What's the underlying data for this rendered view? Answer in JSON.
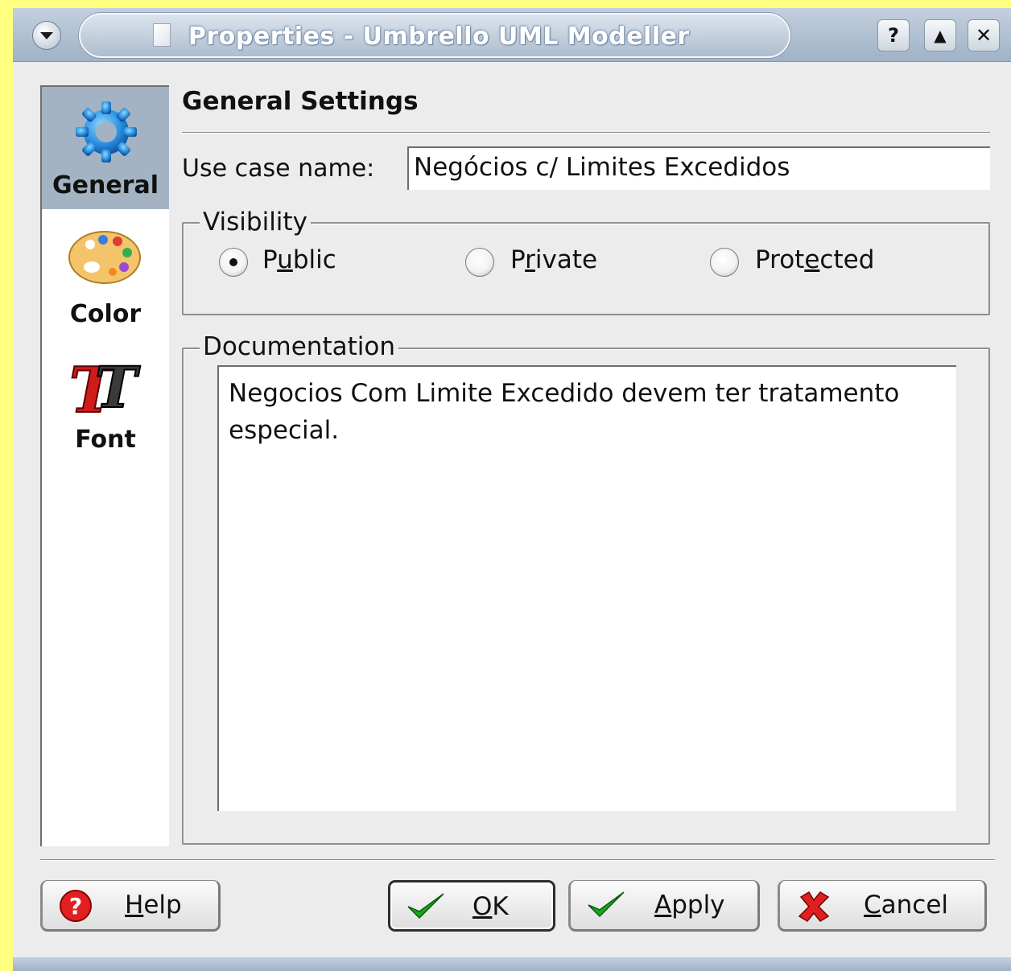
{
  "window": {
    "title": "Properties - Umbrello UML Modeller",
    "buttons": {
      "help": "?",
      "maximize": "▲",
      "close": "✕"
    }
  },
  "sidebar": {
    "items": [
      {
        "label": "General",
        "icon": "gear-icon",
        "active": true
      },
      {
        "label": "Color",
        "icon": "palette-icon",
        "active": false
      },
      {
        "label": "Font",
        "icon": "font-icon",
        "active": false
      }
    ]
  },
  "general": {
    "section_title": "General Settings",
    "name_label": "Use case name:",
    "name_value": "Negócios c/ Limites Excedidos",
    "visibility": {
      "title": "Visibility",
      "options": [
        {
          "label_pre": "P",
          "label_mnemonic": "u",
          "label_post": "blic",
          "checked": true
        },
        {
          "label_pre": "P",
          "label_mnemonic": "r",
          "label_post": "ivate",
          "checked": false
        },
        {
          "label_pre": "Prot",
          "label_mnemonic": "e",
          "label_post": "cted",
          "checked": false
        }
      ]
    },
    "documentation": {
      "title": "Documentation",
      "text": "Negocios Com Limite Excedido devem ter tratamento especial."
    }
  },
  "buttons": {
    "help": {
      "mnemonic": "H",
      "rest": "elp"
    },
    "ok": {
      "mnemonic": "O",
      "rest": "K"
    },
    "apply": {
      "mnemonic": "A",
      "rest": "pply"
    },
    "cancel": {
      "mnemonic": "C",
      "rest": "ancel"
    }
  },
  "colors": {
    "highlight": "#a3b3c3",
    "titlebar": "#9fb2c7",
    "check_green": "#18a818",
    "cancel_red": "#e02020"
  }
}
